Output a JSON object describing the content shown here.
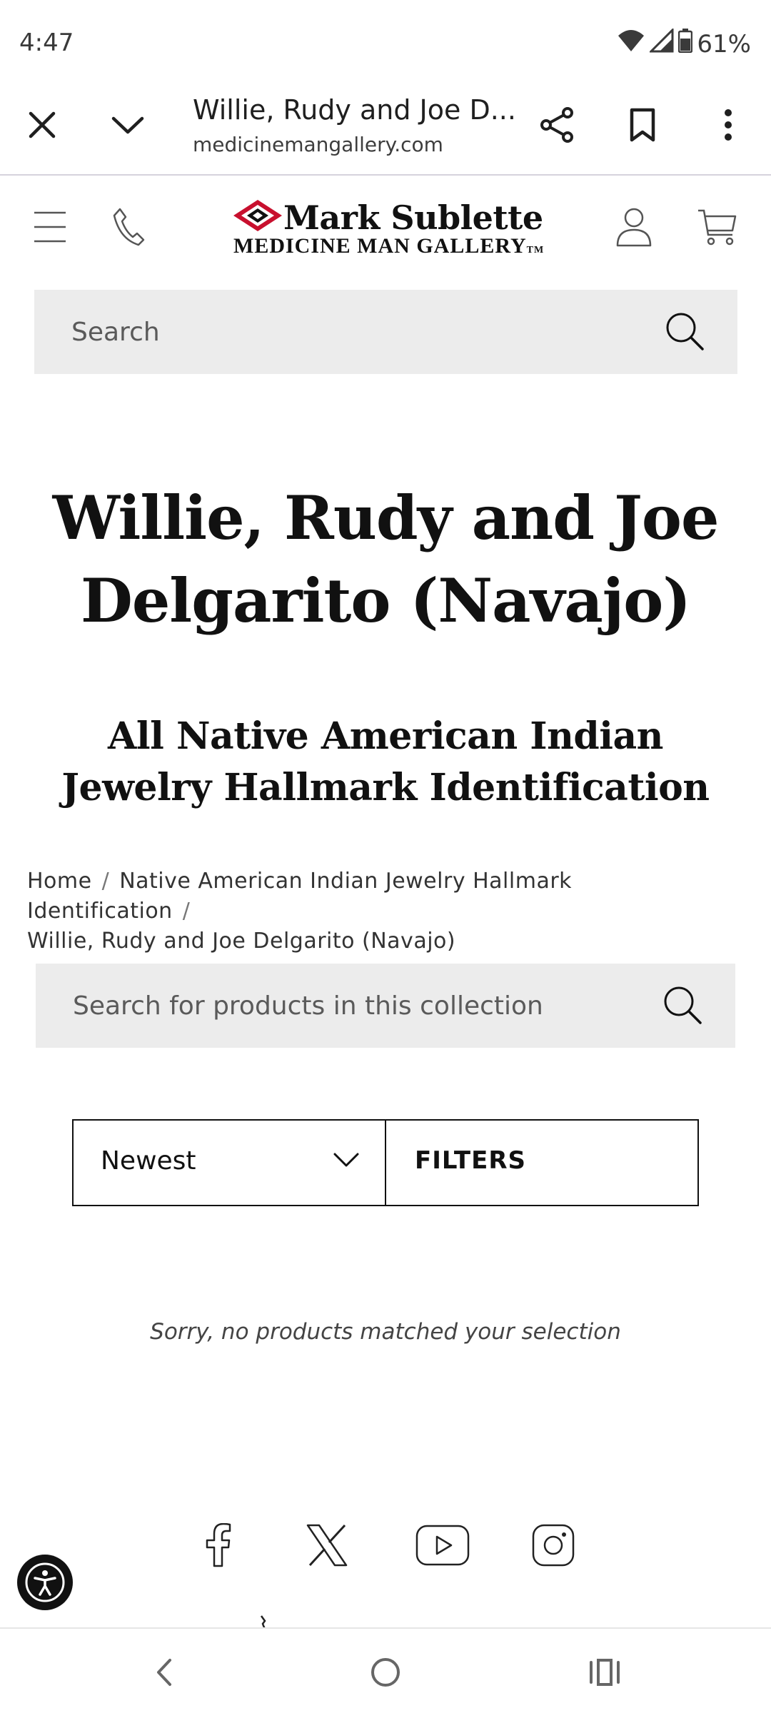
{
  "status_bar": {
    "time": "4:47",
    "battery": "61%"
  },
  "browser": {
    "tab_title": "Willie, Rudy and Joe D...",
    "url": "medicinemangallery.com"
  },
  "logo": {
    "line1": "Mark Sublette",
    "line2": "MEDICINE MAN GALLERY",
    "tm": "TM"
  },
  "header_search": {
    "placeholder": "Search"
  },
  "page": {
    "title": "Willie, Rudy and Joe Delgarito (Navajo)",
    "section_title": "All Native American Indian Jewelry Hallmark Identification"
  },
  "breadcrumb": {
    "home": "Home",
    "parent": "Native American Indian Jewelry Hallmark Identification",
    "current": "Willie, Rudy and Joe Delgarito (Navajo)",
    "separator": "/"
  },
  "collection_search": {
    "placeholder": "Search for products in this collection"
  },
  "controls": {
    "sort_selected": "Newest",
    "filters_label": "FILTERS"
  },
  "empty_message": "Sorry, no products matched your selection",
  "footer": {
    "social_icons": [
      "facebook-icon",
      "x-icon",
      "youtube-icon",
      "instagram-icon"
    ]
  },
  "colors": {
    "logo_red": "#c8102e",
    "search_bg": "#ececec"
  }
}
